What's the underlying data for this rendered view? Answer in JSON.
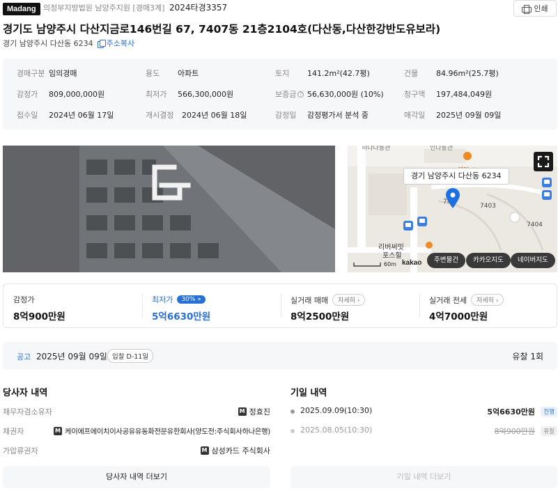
{
  "header": {
    "logo": "Madang",
    "court": "의정부지방법원 남양주지원 [경매3계]",
    "case_no": "2024타경3357",
    "print_label": "인쇄"
  },
  "title": "경기도 남양주시 다산지금로146번길 67, 7407동 21층2104호(다산동,다산한강반도유보라)",
  "sub_address": "경기 남양주시 다산동 6234",
  "copy_label": "주소복사",
  "info": [
    [
      {
        "k": "경매구분",
        "v": "임의경매"
      },
      {
        "k": "용도",
        "v": "아파트"
      },
      {
        "k": "토지",
        "v": "141.2m²(42.7평)"
      },
      {
        "k": "건물",
        "v": "84.96m²(25.7평)"
      }
    ],
    [
      {
        "k": "감정가",
        "v": "809,000,000원"
      },
      {
        "k": "최저가",
        "v": "566,300,000원"
      },
      {
        "k": "보증금",
        "v": "56,630,000원 (10%)"
      },
      {
        "k": "청구액",
        "v": "197,484,049원"
      }
    ],
    [
      {
        "k": "접수일",
        "v": "2024년 06월 17일"
      },
      {
        "k": "개시결정",
        "v": "2024년 06월 18일"
      },
      {
        "k": "감정일",
        "v": "감정평가서 분석 중"
      },
      {
        "k": "매각일",
        "v": "2025년 09월 09일"
      }
    ]
  ],
  "map": {
    "popup": "경기 남양주시 다산동 6234",
    "labels": [
      "7403",
      "7404",
      "74",
      "리버써밋",
      "포스힐",
      "엔터 4"
    ],
    "scale": "60m",
    "brand": "kakao",
    "buttons": [
      "주변물건",
      "카카오지도",
      "네이버지도"
    ]
  },
  "prices": {
    "appraised": {
      "label": "감정가",
      "value": "8억900만원"
    },
    "minimum": {
      "label": "최저가",
      "badge": "30%",
      "value": "5억6630만원"
    },
    "real_sale": {
      "label": "실거래 매매",
      "detail": "자세히",
      "value": "8억2500만원"
    },
    "real_jeonse": {
      "label": "실거래 전세",
      "detail": "자세히",
      "value": "4억7000만원"
    }
  },
  "notice": {
    "label": "공고",
    "date": "2025년 09월 09일",
    "dday": "입찰 D-11일",
    "fail": "유찰 1회"
  },
  "parties": {
    "title": "당사자 내역",
    "rows": [
      {
        "role": "채무자겸소유자",
        "name": "정효진"
      },
      {
        "role": "채권자",
        "name": "케이에프에이치이사공유유동화전문유한회사(양도전:주식회사하나은행)"
      },
      {
        "role": "가압류권자",
        "name": "삼성카드 주식회사"
      }
    ],
    "more": "당사자 내역 더보기"
  },
  "history": {
    "title": "기일 내역",
    "rows": [
      {
        "date": "2025.09.09(10:30)",
        "amount": "5억6630만원",
        "status": "진행"
      },
      {
        "date": "2025.08.05(10:30)",
        "amount": "8억900만원",
        "status": "유찰"
      }
    ],
    "more": "기일 내역 더보기"
  },
  "colors": {
    "accent": "#2a6fd6",
    "map_pin": "#1e6fe0"
  }
}
